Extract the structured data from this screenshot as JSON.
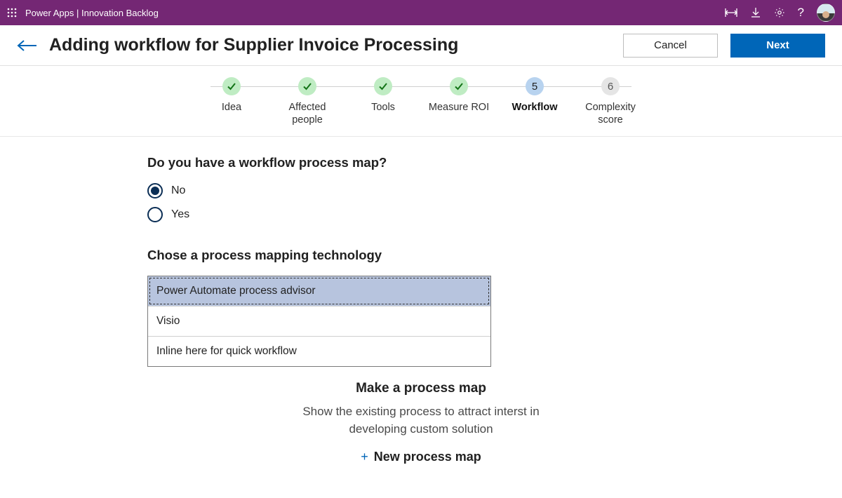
{
  "topbar": {
    "title": "Power Apps  |  Innovation Backlog"
  },
  "header": {
    "title": "Adding workflow for Supplier Invoice Processing",
    "cancel": "Cancel",
    "next": "Next"
  },
  "stepper": {
    "steps": [
      {
        "label": "Idea",
        "state": "done"
      },
      {
        "label": "Affected people",
        "state": "done"
      },
      {
        "label": "Tools",
        "state": "done"
      },
      {
        "label": "Measure ROI",
        "state": "done"
      },
      {
        "label": "Workflow",
        "state": "current",
        "num": "5"
      },
      {
        "label": "Complexity score",
        "state": "future",
        "num": "6"
      }
    ]
  },
  "question": {
    "heading": "Do you have a workflow process map?",
    "options": [
      {
        "label": "No",
        "selected": true
      },
      {
        "label": "Yes",
        "selected": false
      }
    ]
  },
  "tech": {
    "heading": "Chose a process mapping technology",
    "items": [
      {
        "label": "Power Automate process advisor",
        "selected": true
      },
      {
        "label": "Visio",
        "selected": false
      },
      {
        "label": "Inline here for quick workflow",
        "selected": false
      }
    ]
  },
  "processMap": {
    "heading": "Make a process map",
    "helper": "Show the existing process to attract interst in developing custom solution",
    "newLink": "New process map"
  }
}
